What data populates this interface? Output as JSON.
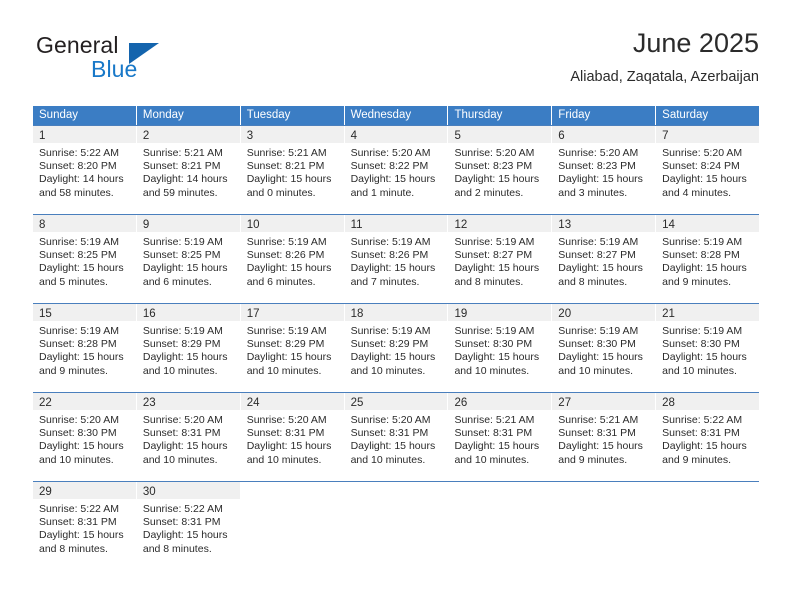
{
  "brand": {
    "name_part1": "General",
    "name_part2": "Blue",
    "triangle_icon": "brand-triangle-icon",
    "colors": {
      "dark": "#231f20",
      "blue": "#1878c8",
      "triangle": "#1464ad"
    }
  },
  "header": {
    "title": "June 2025",
    "subtitle": "Aliabad, Zaqatala, Azerbaijan"
  },
  "calendar": {
    "accent_color": "#3b7dc4",
    "day_band_color": "#f0f0f0",
    "weekdays": [
      "Sunday",
      "Monday",
      "Tuesday",
      "Wednesday",
      "Thursday",
      "Friday",
      "Saturday"
    ],
    "weeks": [
      [
        {
          "day": "1",
          "sunrise": "Sunrise: 5:22 AM",
          "sunset": "Sunset: 8:20 PM",
          "daylight1": "Daylight: 14 hours",
          "daylight2": "and 58 minutes."
        },
        {
          "day": "2",
          "sunrise": "Sunrise: 5:21 AM",
          "sunset": "Sunset: 8:21 PM",
          "daylight1": "Daylight: 14 hours",
          "daylight2": "and 59 minutes."
        },
        {
          "day": "3",
          "sunrise": "Sunrise: 5:21 AM",
          "sunset": "Sunset: 8:21 PM",
          "daylight1": "Daylight: 15 hours",
          "daylight2": "and 0 minutes."
        },
        {
          "day": "4",
          "sunrise": "Sunrise: 5:20 AM",
          "sunset": "Sunset: 8:22 PM",
          "daylight1": "Daylight: 15 hours",
          "daylight2": "and 1 minute."
        },
        {
          "day": "5",
          "sunrise": "Sunrise: 5:20 AM",
          "sunset": "Sunset: 8:23 PM",
          "daylight1": "Daylight: 15 hours",
          "daylight2": "and 2 minutes."
        },
        {
          "day": "6",
          "sunrise": "Sunrise: 5:20 AM",
          "sunset": "Sunset: 8:23 PM",
          "daylight1": "Daylight: 15 hours",
          "daylight2": "and 3 minutes."
        },
        {
          "day": "7",
          "sunrise": "Sunrise: 5:20 AM",
          "sunset": "Sunset: 8:24 PM",
          "daylight1": "Daylight: 15 hours",
          "daylight2": "and 4 minutes."
        }
      ],
      [
        {
          "day": "8",
          "sunrise": "Sunrise: 5:19 AM",
          "sunset": "Sunset: 8:25 PM",
          "daylight1": "Daylight: 15 hours",
          "daylight2": "and 5 minutes."
        },
        {
          "day": "9",
          "sunrise": "Sunrise: 5:19 AM",
          "sunset": "Sunset: 8:25 PM",
          "daylight1": "Daylight: 15 hours",
          "daylight2": "and 6 minutes."
        },
        {
          "day": "10",
          "sunrise": "Sunrise: 5:19 AM",
          "sunset": "Sunset: 8:26 PM",
          "daylight1": "Daylight: 15 hours",
          "daylight2": "and 6 minutes."
        },
        {
          "day": "11",
          "sunrise": "Sunrise: 5:19 AM",
          "sunset": "Sunset: 8:26 PM",
          "daylight1": "Daylight: 15 hours",
          "daylight2": "and 7 minutes."
        },
        {
          "day": "12",
          "sunrise": "Sunrise: 5:19 AM",
          "sunset": "Sunset: 8:27 PM",
          "daylight1": "Daylight: 15 hours",
          "daylight2": "and 8 minutes."
        },
        {
          "day": "13",
          "sunrise": "Sunrise: 5:19 AM",
          "sunset": "Sunset: 8:27 PM",
          "daylight1": "Daylight: 15 hours",
          "daylight2": "and 8 minutes."
        },
        {
          "day": "14",
          "sunrise": "Sunrise: 5:19 AM",
          "sunset": "Sunset: 8:28 PM",
          "daylight1": "Daylight: 15 hours",
          "daylight2": "and 9 minutes."
        }
      ],
      [
        {
          "day": "15",
          "sunrise": "Sunrise: 5:19 AM",
          "sunset": "Sunset: 8:28 PM",
          "daylight1": "Daylight: 15 hours",
          "daylight2": "and 9 minutes."
        },
        {
          "day": "16",
          "sunrise": "Sunrise: 5:19 AM",
          "sunset": "Sunset: 8:29 PM",
          "daylight1": "Daylight: 15 hours",
          "daylight2": "and 10 minutes."
        },
        {
          "day": "17",
          "sunrise": "Sunrise: 5:19 AM",
          "sunset": "Sunset: 8:29 PM",
          "daylight1": "Daylight: 15 hours",
          "daylight2": "and 10 minutes."
        },
        {
          "day": "18",
          "sunrise": "Sunrise: 5:19 AM",
          "sunset": "Sunset: 8:29 PM",
          "daylight1": "Daylight: 15 hours",
          "daylight2": "and 10 minutes."
        },
        {
          "day": "19",
          "sunrise": "Sunrise: 5:19 AM",
          "sunset": "Sunset: 8:30 PM",
          "daylight1": "Daylight: 15 hours",
          "daylight2": "and 10 minutes."
        },
        {
          "day": "20",
          "sunrise": "Sunrise: 5:19 AM",
          "sunset": "Sunset: 8:30 PM",
          "daylight1": "Daylight: 15 hours",
          "daylight2": "and 10 minutes."
        },
        {
          "day": "21",
          "sunrise": "Sunrise: 5:19 AM",
          "sunset": "Sunset: 8:30 PM",
          "daylight1": "Daylight: 15 hours",
          "daylight2": "and 10 minutes."
        }
      ],
      [
        {
          "day": "22",
          "sunrise": "Sunrise: 5:20 AM",
          "sunset": "Sunset: 8:30 PM",
          "daylight1": "Daylight: 15 hours",
          "daylight2": "and 10 minutes."
        },
        {
          "day": "23",
          "sunrise": "Sunrise: 5:20 AM",
          "sunset": "Sunset: 8:31 PM",
          "daylight1": "Daylight: 15 hours",
          "daylight2": "and 10 minutes."
        },
        {
          "day": "24",
          "sunrise": "Sunrise: 5:20 AM",
          "sunset": "Sunset: 8:31 PM",
          "daylight1": "Daylight: 15 hours",
          "daylight2": "and 10 minutes."
        },
        {
          "day": "25",
          "sunrise": "Sunrise: 5:20 AM",
          "sunset": "Sunset: 8:31 PM",
          "daylight1": "Daylight: 15 hours",
          "daylight2": "and 10 minutes."
        },
        {
          "day": "26",
          "sunrise": "Sunrise: 5:21 AM",
          "sunset": "Sunset: 8:31 PM",
          "daylight1": "Daylight: 15 hours",
          "daylight2": "and 10 minutes."
        },
        {
          "day": "27",
          "sunrise": "Sunrise: 5:21 AM",
          "sunset": "Sunset: 8:31 PM",
          "daylight1": "Daylight: 15 hours",
          "daylight2": "and 9 minutes."
        },
        {
          "day": "28",
          "sunrise": "Sunrise: 5:22 AM",
          "sunset": "Sunset: 8:31 PM",
          "daylight1": "Daylight: 15 hours",
          "daylight2": "and 9 minutes."
        }
      ],
      [
        {
          "day": "29",
          "sunrise": "Sunrise: 5:22 AM",
          "sunset": "Sunset: 8:31 PM",
          "daylight1": "Daylight: 15 hours",
          "daylight2": "and 8 minutes."
        },
        {
          "day": "30",
          "sunrise": "Sunrise: 5:22 AM",
          "sunset": "Sunset: 8:31 PM",
          "daylight1": "Daylight: 15 hours",
          "daylight2": "and 8 minutes."
        },
        {
          "day": "",
          "sunrise": "",
          "sunset": "",
          "daylight1": "",
          "daylight2": ""
        },
        {
          "day": "",
          "sunrise": "",
          "sunset": "",
          "daylight1": "",
          "daylight2": ""
        },
        {
          "day": "",
          "sunrise": "",
          "sunset": "",
          "daylight1": "",
          "daylight2": ""
        },
        {
          "day": "",
          "sunrise": "",
          "sunset": "",
          "daylight1": "",
          "daylight2": ""
        },
        {
          "day": "",
          "sunrise": "",
          "sunset": "",
          "daylight1": "",
          "daylight2": ""
        }
      ]
    ]
  }
}
